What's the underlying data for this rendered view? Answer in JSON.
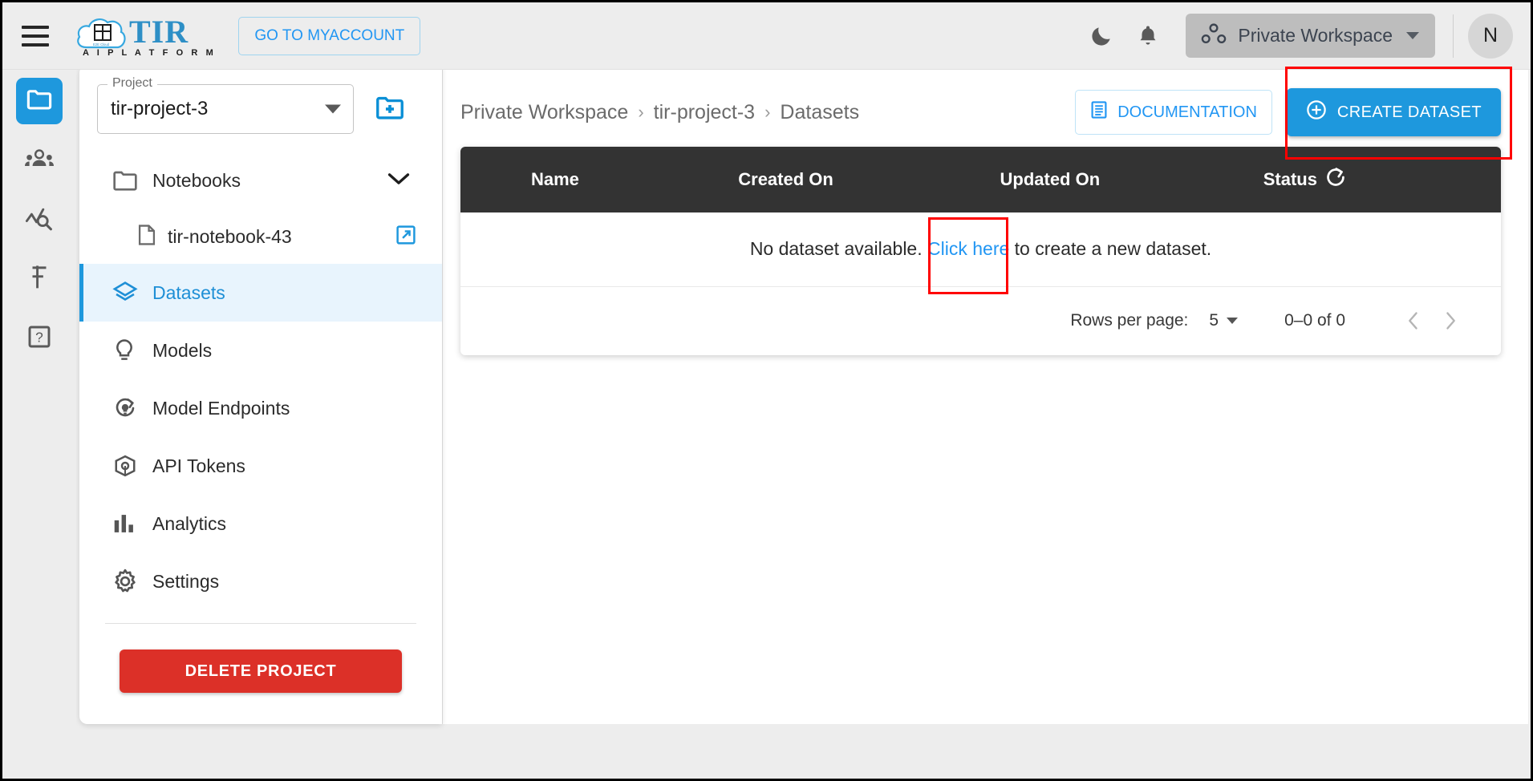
{
  "topbar": {
    "menu_icon": "hamburger-menu-icon",
    "logo": {
      "name": "TIR",
      "tagline": "A I   P L A T F O R M",
      "mark": "cloud-grid-logo"
    },
    "myaccount_label": "GO TO MYACCOUNT",
    "theme_icon": "moon-icon",
    "notifications_icon": "bell-icon",
    "workspace": {
      "label": "Private Workspace",
      "icon": "workspace-dots-icon"
    },
    "avatar_initial": "N"
  },
  "rail": {
    "items": [
      {
        "name": "projects",
        "icon": "folder-icon",
        "active": true
      },
      {
        "name": "team",
        "icon": "people-group-icon",
        "active": false
      },
      {
        "name": "monitoring",
        "icon": "analytics-search-icon",
        "active": false
      },
      {
        "name": "billing",
        "icon": "rupee-icon",
        "active": false
      },
      {
        "name": "help",
        "icon": "question-box-icon",
        "active": false
      }
    ]
  },
  "project_panel": {
    "select": {
      "legend": "Project",
      "value": "tir-project-3"
    },
    "new_project_icon": "folder-plus-icon",
    "nav": [
      {
        "label": "Notebooks",
        "icon": "folder-outline-icon",
        "type": "group",
        "expanded": true,
        "chevron": "chevron-down-icon"
      },
      {
        "label": "tir-notebook-43",
        "icon": "file-icon",
        "type": "subitem",
        "action_icon": "open-external-icon"
      },
      {
        "label": "Datasets",
        "icon": "layers-icon",
        "type": "item",
        "active": true
      },
      {
        "label": "Models",
        "icon": "lightbulb-icon",
        "type": "item"
      },
      {
        "label": "Model Endpoints",
        "icon": "endpoint-icon",
        "type": "item"
      },
      {
        "label": "API Tokens",
        "icon": "cube-icon",
        "type": "item"
      },
      {
        "label": "Analytics",
        "icon": "bar-chart-icon",
        "type": "item"
      },
      {
        "label": "Settings",
        "icon": "gear-icon",
        "type": "item"
      }
    ],
    "delete_label": "DELETE PROJECT"
  },
  "main": {
    "breadcrumb": [
      "Private Workspace",
      "tir-project-3",
      "Datasets"
    ],
    "breadcrumb_separator": "›",
    "documentation_label": "DOCUMENTATION",
    "documentation_icon": "document-icon",
    "create_label": "CREATE DATASET",
    "create_icon": "plus-circle-icon",
    "table": {
      "columns": [
        "Name",
        "Created On",
        "Updated On",
        "Status"
      ],
      "status_refresh_icon": "refresh-icon",
      "rows": [],
      "empty_text_before": "No dataset available.",
      "empty_link": "Click here",
      "empty_text_after": "to create a new dataset."
    },
    "pagination": {
      "rows_per_page_label": "Rows per page:",
      "rows_per_page_value": "5",
      "range_label": "0–0 of 0",
      "prev_icon": "chevron-left-icon",
      "next_icon": "chevron-right-icon"
    }
  },
  "annotations": {
    "create_dataset_highlight": "red-rectangle",
    "click_here_highlight": "red-rectangle",
    "color": "#ff0000"
  },
  "colors": {
    "accent_blue": "#1e98dd",
    "link_blue": "#2196f3",
    "danger_red": "#dc3028",
    "table_header": "#333333",
    "active_nav_bg": "#e8f4fd"
  }
}
